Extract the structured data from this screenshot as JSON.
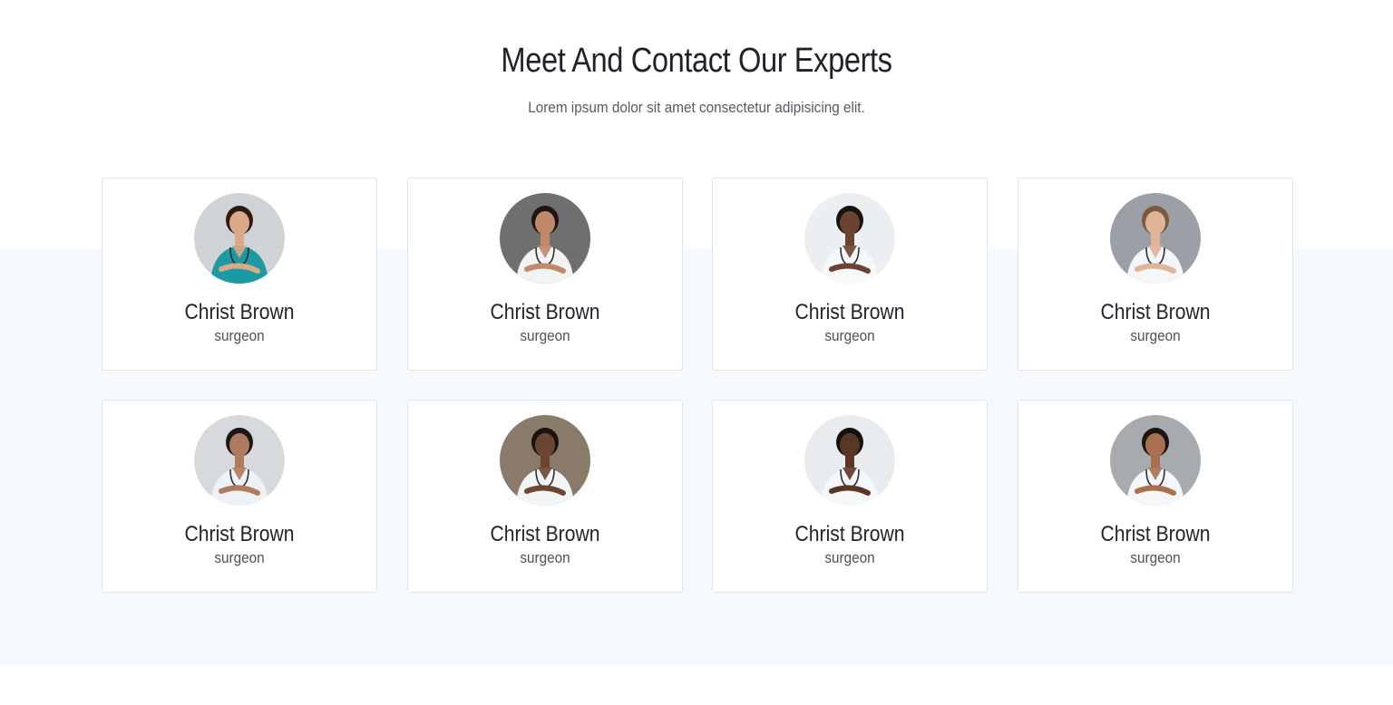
{
  "section": {
    "title": "Meet And Contact Our Experts",
    "subtitle": "Lorem ipsum dolor sit amet consectetur adipisicing elit."
  },
  "experts": [
    {
      "name": "Christ Brown",
      "role": "surgeon",
      "photo_bg": "#cfd3d6",
      "outfit": "#1b9aa3",
      "skin": "#d9a98a",
      "hair": "#2b1c15"
    },
    {
      "name": "Christ Brown",
      "role": "surgeon",
      "photo_bg": "#6f6f6f",
      "outfit": "#f1f3f4",
      "skin": "#c08a6a",
      "hair": "#1d1612"
    },
    {
      "name": "Christ Brown",
      "role": "surgeon",
      "photo_bg": "#eceff1",
      "outfit": "#f7f8f9",
      "skin": "#6b4330",
      "hair": "#161210"
    },
    {
      "name": "Christ Brown",
      "role": "surgeon",
      "photo_bg": "#9aa0a5",
      "outfit": "#f4f6f8",
      "skin": "#e0b497",
      "hair": "#7a5a3e"
    },
    {
      "name": "Christ Brown",
      "role": "surgeon",
      "photo_bg": "#d7dadc",
      "outfit": "#eef2f6",
      "skin": "#b07a5c",
      "hair": "#1c1714"
    },
    {
      "name": "Christ Brown",
      "role": "surgeon",
      "photo_bg": "#8a7a6a",
      "outfit": "#f3f4f5",
      "skin": "#6d4633",
      "hair": "#1a1411"
    },
    {
      "name": "Christ Brown",
      "role": "surgeon",
      "photo_bg": "#e9ecee",
      "outfit": "#f6f7f8",
      "skin": "#5a3626",
      "hair": "#15100d"
    },
    {
      "name": "Christ Brown",
      "role": "surgeon",
      "photo_bg": "#a7abae",
      "outfit": "#f5f6f7",
      "skin": "#a8704f",
      "hair": "#1b1512"
    }
  ]
}
